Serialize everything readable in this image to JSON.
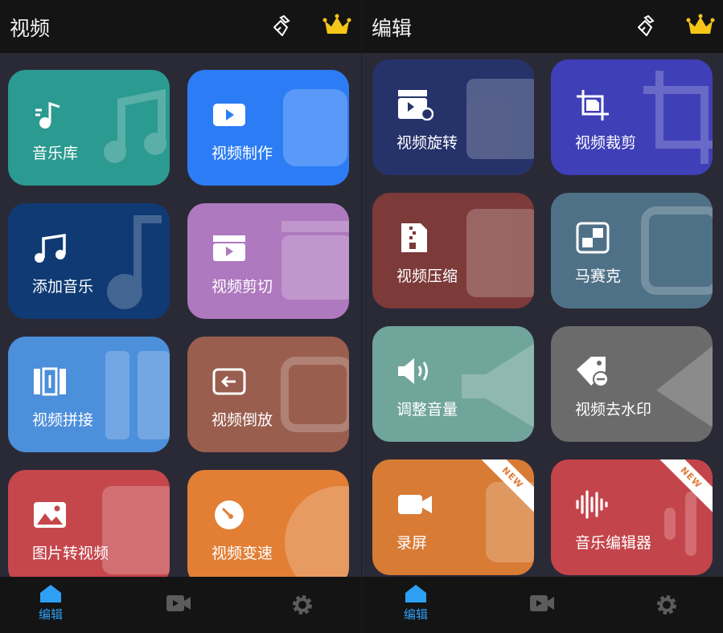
{
  "left": {
    "title": "视频",
    "cards": [
      {
        "label": "音乐库",
        "color": "#2b9a90",
        "icon": "music-note-icon"
      },
      {
        "label": "视频制作",
        "color": "#2c7df5",
        "icon": "video-play-icon"
      },
      {
        "label": "添加音乐",
        "color": "#0f3a73",
        "icon": "music-notes-icon"
      },
      {
        "label": "视频剪切",
        "color": "#ae79bf",
        "icon": "clapper-icon"
      },
      {
        "label": "视频拼接",
        "color": "#4c8fdb",
        "icon": "splice-icon"
      },
      {
        "label": "视频倒放",
        "color": "#9a5e4f",
        "icon": "reverse-icon"
      },
      {
        "label": "图片转视频",
        "color": "#c5474c",
        "icon": "image-icon"
      },
      {
        "label": "视频变速",
        "color": "#e27f35",
        "icon": "speed-gauge-icon"
      }
    ],
    "nav": {
      "edit_label": "编辑"
    }
  },
  "right": {
    "title": "编辑",
    "cards": [
      {
        "label": "视频旋转",
        "color": "#26336b",
        "icon": "rotate-video-icon"
      },
      {
        "label": "视频裁剪",
        "color": "#3f3fb8",
        "icon": "crop-icon"
      },
      {
        "label": "视频压缩",
        "color": "#7c3a39",
        "icon": "compress-file-icon"
      },
      {
        "label": "马赛克",
        "color": "#4f7187",
        "icon": "mosaic-icon"
      },
      {
        "label": "调整音量",
        "color": "#70a59b",
        "icon": "volume-icon"
      },
      {
        "label": "视频去水印",
        "color": "#6b6b6b",
        "icon": "watermark-tag-icon"
      },
      {
        "label": "录屏",
        "color": "#d87b35",
        "icon": "camera-icon",
        "badge": "NEW"
      },
      {
        "label": "音乐编辑器",
        "color": "#c4444b",
        "icon": "sound-wave-icon",
        "badge": "NEW"
      }
    ],
    "nav": {
      "edit_label": "编辑"
    }
  },
  "colors": {
    "accent": "#2f9ff4",
    "crown": "#f5c518",
    "topbar": "#141414",
    "background": "#2a2a36"
  }
}
